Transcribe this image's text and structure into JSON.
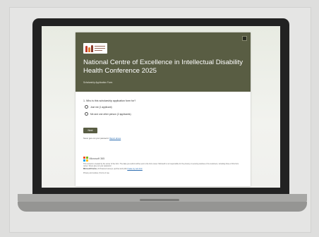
{
  "form": {
    "title": "National Centre of Excellence in Intellectual Disability Health Conference 2025",
    "subtitle": "Scholarship Application Form",
    "question": "1. Who is this scholarship application form for?",
    "options": [
      {
        "label": "Just me (1 applicant)",
        "selected": false
      },
      {
        "label": "Me and one other person (2 applicants)",
        "selected": false
      }
    ],
    "next_label": "Next",
    "never_password": "Never give out your password.",
    "report_abuse": "Report abuse",
    "banner_color": "#595d43"
  },
  "footer": {
    "brand": "Microsoft 365",
    "line1": "This content is created by the owner of the form. The data you submit will be sent to the form owner. Microsoft is not responsible for the privacy or security practices of its customers, including those of this form owner. Never give out your password.",
    "line2_bold": "Microsoft Forms",
    "line2_text": "| AI-Powered surveys, quizzes and polls",
    "line2_link": "Create my own form",
    "line3": "Privacy and cookies | Terms of use",
    "ms_colors": [
      "#f25022",
      "#7fba00",
      "#00a4ef",
      "#ffb900"
    ]
  }
}
